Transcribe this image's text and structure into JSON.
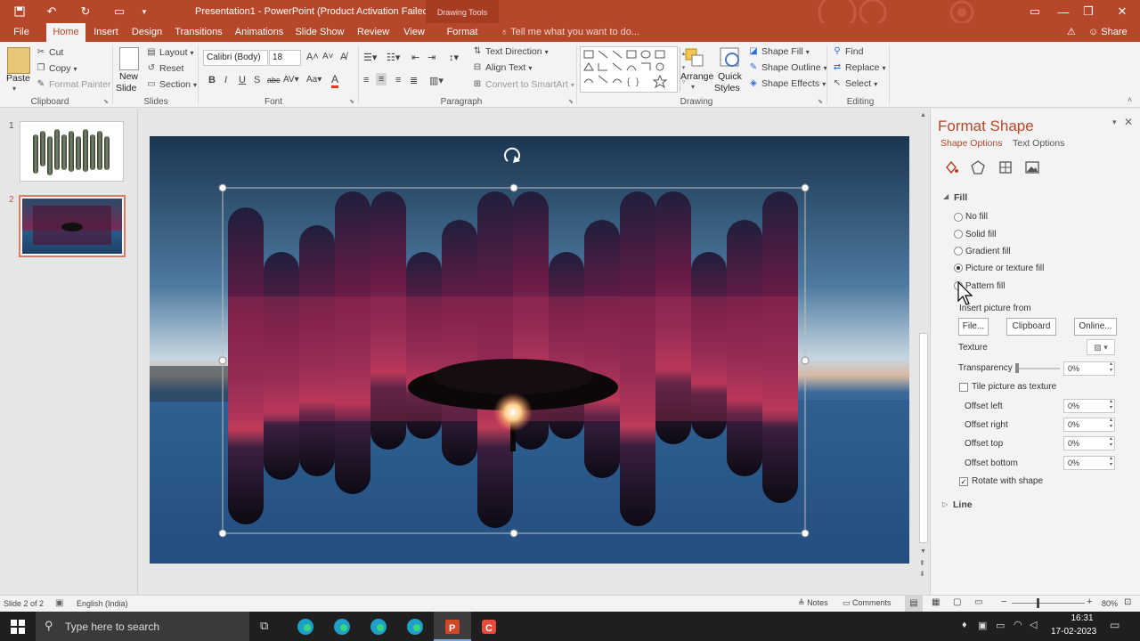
{
  "titlebar": {
    "title": "Presentation1 - PowerPoint (Product Activation Failed)",
    "context_tab": "Drawing Tools"
  },
  "tabs": {
    "items": [
      "File",
      "Home",
      "Insert",
      "Design",
      "Transitions",
      "Animations",
      "Slide Show",
      "Review",
      "View",
      "Format"
    ],
    "active": "Home",
    "tell_me": "Tell me what you want to do...",
    "share": "Share"
  },
  "ribbon": {
    "clipboard": {
      "paste": "Paste",
      "cut": "Cut",
      "copy": "Copy",
      "format_painter": "Format Painter",
      "label": "Clipboard"
    },
    "slides": {
      "new_slide_1": "New",
      "new_slide_2": "Slide",
      "layout": "Layout",
      "reset": "Reset",
      "section": "Section",
      "label": "Slides"
    },
    "font": {
      "name": "Calibri (Body)",
      "size": "18",
      "label": "Font"
    },
    "paragraph": {
      "text_direction": "Text Direction",
      "align_text": "Align Text",
      "smartart": "Convert to SmartArt",
      "label": "Paragraph"
    },
    "drawing": {
      "arrange": "Arrange",
      "quick_styles_1": "Quick",
      "quick_styles_2": "Styles",
      "shape_fill": "Shape Fill",
      "shape_outline": "Shape Outline",
      "shape_effects": "Shape Effects",
      "label": "Drawing"
    },
    "editing": {
      "find": "Find",
      "replace": "Replace",
      "select": "Select",
      "label": "Editing"
    }
  },
  "thumbnails": [
    {
      "number": "1"
    },
    {
      "number": "2"
    }
  ],
  "format_pane": {
    "title": "Format Shape",
    "tab_shape": "Shape Options",
    "tab_text": "Text Options",
    "section_fill": "Fill",
    "fill_options": [
      "No fill",
      "Solid fill",
      "Gradient fill",
      "Picture or texture fill",
      "Pattern fill"
    ],
    "selected_fill": "Picture or texture fill",
    "insert_from": "Insert picture from",
    "btn_file": "File...",
    "btn_clipboard": "Clipboard",
    "btn_online": "Online...",
    "texture": "Texture",
    "transparency": "Transparency",
    "transparency_value": "0%",
    "tile": "Tile picture as texture",
    "offset_left": "Offset left",
    "offset_right": "Offset right",
    "offset_top": "Offset top",
    "offset_bottom": "Offset bottom",
    "offset_value": "0%",
    "rotate": "Rotate with shape",
    "section_line": "Line"
  },
  "status": {
    "slide": "Slide 2 of 2",
    "language": "English (India)",
    "notes": "Notes",
    "comments": "Comments",
    "zoom": "80%"
  },
  "taskbar": {
    "search": "Type here to search",
    "time": "16:31",
    "date": "17-02-2023"
  }
}
